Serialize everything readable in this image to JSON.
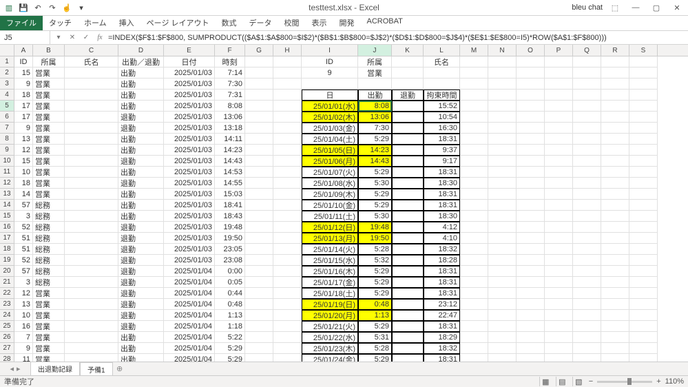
{
  "app": {
    "title": "testtest.xlsx - Excel",
    "user": "bleu chat"
  },
  "ribbon": {
    "file": "ファイル",
    "tabs": [
      "タッチ",
      "ホーム",
      "挿入",
      "ページ レイアウト",
      "数式",
      "データ",
      "校閲",
      "表示",
      "開発",
      "ACROBAT"
    ]
  },
  "namebox": "J5",
  "formula": "=INDEX($F$1:$F$800, SUMPRODUCT(($A$1:$A$800=$I$2)*($B$1:$B$800=$J$2)*($D$1:$D$800=$J$4)*($E$1:$E$800=I5)*ROW($A$1:$F$800)))",
  "cols": [
    "A",
    "B",
    "C",
    "D",
    "E",
    "F",
    "G",
    "H",
    "I",
    "J",
    "K",
    "L",
    "M",
    "N",
    "O",
    "P",
    "Q",
    "R",
    "S"
  ],
  "leftHeaders": {
    "A": "ID",
    "B": "所属",
    "C": "氏名",
    "D": "出勤／退勤",
    "E": "日付",
    "F": "時刻"
  },
  "rightHdr1": {
    "I": "ID",
    "J": "所属",
    "L": "氏名"
  },
  "rightHdr2": {
    "I": "9",
    "J": "営業"
  },
  "rightHdr4": {
    "I": "日",
    "J": "出勤",
    "K": "退勤",
    "L": "拘束時間"
  },
  "left": [
    {
      "A": "15",
      "B": "営業",
      "D": "出勤",
      "E": "2025/01/03",
      "F": "7:14"
    },
    {
      "A": "9",
      "B": "営業",
      "D": "出勤",
      "E": "2025/01/03",
      "F": "7:30"
    },
    {
      "A": "18",
      "B": "営業",
      "D": "出勤",
      "E": "2025/01/03",
      "F": "7:31"
    },
    {
      "A": "17",
      "B": "営業",
      "D": "出勤",
      "E": "2025/01/03",
      "F": "8:08"
    },
    {
      "A": "17",
      "B": "営業",
      "D": "退勤",
      "E": "2025/01/03",
      "F": "13:06"
    },
    {
      "A": "9",
      "B": "営業",
      "D": "退勤",
      "E": "2025/01/03",
      "F": "13:18"
    },
    {
      "A": "13",
      "B": "営業",
      "D": "出勤",
      "E": "2025/01/03",
      "F": "14:11"
    },
    {
      "A": "12",
      "B": "営業",
      "D": "出勤",
      "E": "2025/01/03",
      "F": "14:23"
    },
    {
      "A": "15",
      "B": "営業",
      "D": "退勤",
      "E": "2025/01/03",
      "F": "14:43"
    },
    {
      "A": "10",
      "B": "営業",
      "D": "出勤",
      "E": "2025/01/03",
      "F": "14:53"
    },
    {
      "A": "18",
      "B": "営業",
      "D": "退勤",
      "E": "2025/01/03",
      "F": "14:55"
    },
    {
      "A": "14",
      "B": "営業",
      "D": "出勤",
      "E": "2025/01/03",
      "F": "15:03"
    },
    {
      "A": "57",
      "B": "総務",
      "D": "出勤",
      "E": "2025/01/03",
      "F": "18:41"
    },
    {
      "A": "3",
      "B": "総務",
      "D": "出勤",
      "E": "2025/01/03",
      "F": "18:43"
    },
    {
      "A": "52",
      "B": "総務",
      "D": "退勤",
      "E": "2025/01/03",
      "F": "19:48"
    },
    {
      "A": "51",
      "B": "総務",
      "D": "退勤",
      "E": "2025/01/03",
      "F": "19:50"
    },
    {
      "A": "51",
      "B": "総務",
      "D": "退勤",
      "E": "2025/01/03",
      "F": "23:05"
    },
    {
      "A": "52",
      "B": "総務",
      "D": "退勤",
      "E": "2025/01/03",
      "F": "23:08"
    },
    {
      "A": "57",
      "B": "総務",
      "D": "退勤",
      "E": "2025/01/04",
      "F": "0:00"
    },
    {
      "A": "3",
      "B": "総務",
      "D": "退勤",
      "E": "2025/01/04",
      "F": "0:05"
    },
    {
      "A": "12",
      "B": "営業",
      "D": "退勤",
      "E": "2025/01/04",
      "F": "0:44"
    },
    {
      "A": "13",
      "B": "営業",
      "D": "退勤",
      "E": "2025/01/04",
      "F": "0:48"
    },
    {
      "A": "10",
      "B": "営業",
      "D": "退勤",
      "E": "2025/01/04",
      "F": "1:13"
    },
    {
      "A": "16",
      "B": "営業",
      "D": "退勤",
      "E": "2025/01/04",
      "F": "1:18"
    },
    {
      "A": "7",
      "B": "営業",
      "D": "出勤",
      "E": "2025/01/04",
      "F": "5:22"
    },
    {
      "A": "9",
      "B": "営業",
      "D": "出勤",
      "E": "2025/01/04",
      "F": "5:29"
    },
    {
      "A": "11",
      "B": "営業",
      "D": "出勤",
      "E": "2025/01/04",
      "F": "5:29"
    }
  ],
  "right": [
    {
      "I": "25/01/01(水)",
      "J": "8:08",
      "L": "15:52",
      "hl": true
    },
    {
      "I": "25/01/02(木)",
      "J": "13:06",
      "L": "10:54",
      "hl": true
    },
    {
      "I": "25/01/03(金)",
      "J": "7:30",
      "L": "16:30"
    },
    {
      "I": "25/01/04(土)",
      "J": "5:29",
      "L": "18:31"
    },
    {
      "I": "25/01/05(日)",
      "J": "14:23",
      "L": "9:37",
      "hl": true
    },
    {
      "I": "25/01/06(月)",
      "J": "14:43",
      "L": "9:17",
      "hl": true
    },
    {
      "I": "25/01/07(火)",
      "J": "5:29",
      "L": "18:31"
    },
    {
      "I": "25/01/08(水)",
      "J": "5:30",
      "L": "18:30"
    },
    {
      "I": "25/01/09(木)",
      "J": "5:29",
      "L": "18:31"
    },
    {
      "I": "25/01/10(金)",
      "J": "5:29",
      "L": "18:31"
    },
    {
      "I": "25/01/11(土)",
      "J": "5:30",
      "L": "18:30"
    },
    {
      "I": "25/01/12(日)",
      "J": "19:48",
      "L": "4:12",
      "hl": true
    },
    {
      "I": "25/01/13(月)",
      "J": "19:50",
      "L": "4:10",
      "hl": true
    },
    {
      "I": "25/01/14(火)",
      "J": "5:28",
      "L": "18:32"
    },
    {
      "I": "25/01/15(水)",
      "J": "5:32",
      "L": "18:28"
    },
    {
      "I": "25/01/16(木)",
      "J": "5:29",
      "L": "18:31"
    },
    {
      "I": "25/01/17(金)",
      "J": "5:29",
      "L": "18:31"
    },
    {
      "I": "25/01/18(土)",
      "J": "5:29",
      "L": "18:31"
    },
    {
      "I": "25/01/19(日)",
      "J": "0:48",
      "L": "23:12",
      "hl": true
    },
    {
      "I": "25/01/20(月)",
      "J": "1:13",
      "L": "22:47",
      "hl": true
    },
    {
      "I": "25/01/21(火)",
      "J": "5:29",
      "L": "18:31"
    },
    {
      "I": "25/01/22(水)",
      "J": "5:31",
      "L": "18:29"
    },
    {
      "I": "25/01/23(木)",
      "J": "5:28",
      "L": "18:32"
    },
    {
      "I": "25/01/24(金)",
      "J": "5:29",
      "L": "18:31"
    }
  ],
  "sheets": {
    "active": "出退勤記録",
    "other": "予備1"
  },
  "status": {
    "ready": "準備完了",
    "zoom": "110%"
  }
}
